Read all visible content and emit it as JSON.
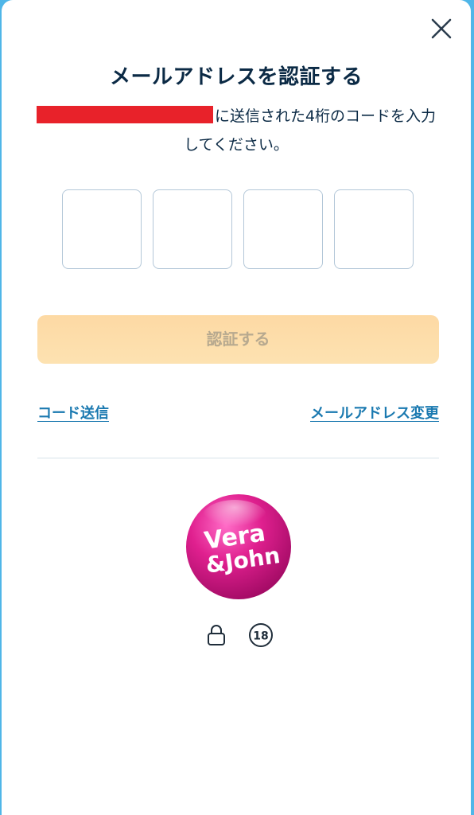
{
  "dialog": {
    "title": "メールアドレスを認証する",
    "description": "に送信された4桁のコードを入力してください。",
    "code_digits": [
      "",
      "",
      "",
      ""
    ],
    "verify_button_label": "認証する",
    "resend_link_label": "コード送信",
    "change_email_link_label": "メールアドレス変更",
    "close_icon": "close-icon"
  },
  "footer": {
    "logo_text_line1": "Vera",
    "logo_text_line2": "&John",
    "lock_icon": "lock-icon",
    "age_badge_text": "18"
  },
  "colors": {
    "background": "#4fb6e8",
    "title": "#0b2a45",
    "link": "#1a79b0",
    "button_bg": "#fdd9a4",
    "button_text": "#b7a98f",
    "redaction": "#e8222a",
    "logo_pink": "#e0208f"
  }
}
